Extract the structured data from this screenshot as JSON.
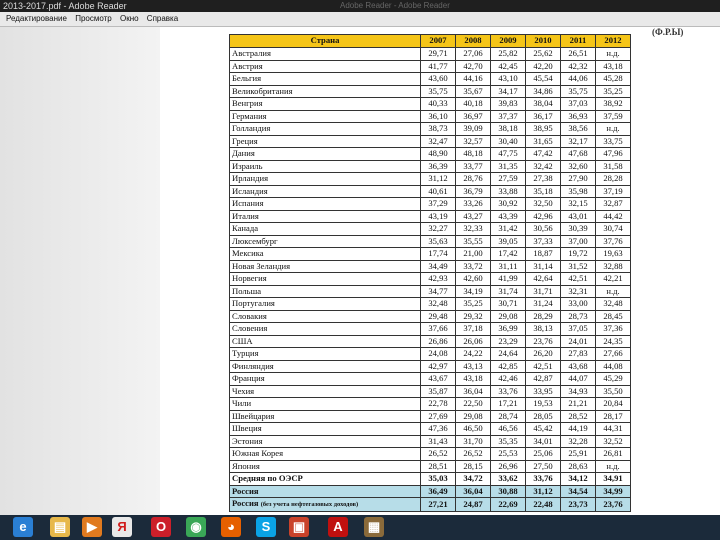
{
  "window": {
    "title": "2013-2017.pdf - Adobe Reader",
    "ghost_text": "Adobe Reader - Adobe Reader"
  },
  "menu": [
    "Редактирование",
    "Просмотр",
    "Окно",
    "Справка"
  ],
  "unit_label": "(Ф.Р.Ы)",
  "table": {
    "headers": [
      "Страна",
      "2007",
      "2008",
      "2009",
      "2010",
      "2011",
      "2012"
    ],
    "rows": [
      [
        "Австралия",
        "29,71",
        "27,06",
        "25,82",
        "25,62",
        "26,51",
        "н.д."
      ],
      [
        "Австрия",
        "41,77",
        "42,70",
        "42,45",
        "42,20",
        "42,32",
        "43,18"
      ],
      [
        "Бельгия",
        "43,60",
        "44,16",
        "43,10",
        "45,54",
        "44,06",
        "45,28"
      ],
      [
        "Великобритания",
        "35,75",
        "35,67",
        "34,17",
        "34,86",
        "35,75",
        "35,25"
      ],
      [
        "Венгрия",
        "40,33",
        "40,18",
        "39,83",
        "38,04",
        "37,03",
        "38,92"
      ],
      [
        "Германия",
        "36,10",
        "36,97",
        "37,37",
        "36,17",
        "36,93",
        "37,59"
      ],
      [
        "Голландия",
        "38,73",
        "39,09",
        "38,18",
        "38,95",
        "38,56",
        "н.д."
      ],
      [
        "Греция",
        "32,47",
        "32,57",
        "30,40",
        "31,65",
        "32,17",
        "33,75"
      ],
      [
        "Дания",
        "48,90",
        "48,18",
        "47,75",
        "47,42",
        "47,68",
        "47,96"
      ],
      [
        "Израиль",
        "36,39",
        "33,77",
        "31,35",
        "32,42",
        "32,60",
        "31,58"
      ],
      [
        "Ирландия",
        "31,12",
        "28,76",
        "27,59",
        "27,38",
        "27,90",
        "28,28"
      ],
      [
        "Исландия",
        "40,61",
        "36,79",
        "33,88",
        "35,18",
        "35,98",
        "37,19"
      ],
      [
        "Испания",
        "37,29",
        "33,26",
        "30,92",
        "32,50",
        "32,15",
        "32,87"
      ],
      [
        "Италия",
        "43,19",
        "43,27",
        "43,39",
        "42,96",
        "43,01",
        "44,42"
      ],
      [
        "Канада",
        "32,27",
        "32,33",
        "31,42",
        "30,56",
        "30,39",
        "30,74"
      ],
      [
        "Люксембург",
        "35,63",
        "35,55",
        "39,05",
        "37,33",
        "37,00",
        "37,76"
      ],
      [
        "Мексика",
        "17,74",
        "21,00",
        "17,42",
        "18,87",
        "19,72",
        "19,63"
      ],
      [
        "Новая Зеландия",
        "34,49",
        "33,72",
        "31,11",
        "31,14",
        "31,52",
        "32,88"
      ],
      [
        "Норвегия",
        "42,93",
        "42,60",
        "41,99",
        "42,64",
        "42,51",
        "42,21"
      ],
      [
        "Польша",
        "34,77",
        "34,19",
        "31,74",
        "31,71",
        "32,31",
        "н.д."
      ],
      [
        "Португалия",
        "32,48",
        "35,25",
        "30,71",
        "31,24",
        "33,00",
        "32,48"
      ],
      [
        "Словакия",
        "29,48",
        "29,32",
        "29,08",
        "28,29",
        "28,73",
        "28,45"
      ],
      [
        "Словения",
        "37,66",
        "37,18",
        "36,99",
        "38,13",
        "37,05",
        "37,36"
      ],
      [
        "США",
        "26,86",
        "26,06",
        "23,29",
        "23,76",
        "24,01",
        "24,35"
      ],
      [
        "Турция",
        "24,08",
        "24,22",
        "24,64",
        "26,20",
        "27,83",
        "27,66"
      ],
      [
        "Финляндия",
        "42,97",
        "43,13",
        "42,85",
        "42,51",
        "43,68",
        "44,08"
      ],
      [
        "Франция",
        "43,67",
        "43,18",
        "42,46",
        "42,87",
        "44,07",
        "45,29"
      ],
      [
        "Чехия",
        "35,87",
        "36,04",
        "33,76",
        "33,95",
        "34,93",
        "35,50"
      ],
      [
        "Чили",
        "22,78",
        "22,50",
        "17,21",
        "19,53",
        "21,21",
        "20,84"
      ],
      [
        "Швейцария",
        "27,69",
        "29,08",
        "28,74",
        "28,05",
        "28,52",
        "28,17"
      ],
      [
        "Швеция",
        "47,36",
        "46,50",
        "46,56",
        "45,42",
        "44,19",
        "44,31"
      ],
      [
        "Эстония",
        "31,43",
        "31,70",
        "35,35",
        "34,01",
        "32,28",
        "32,52"
      ],
      [
        "Южная Корея",
        "26,52",
        "26,52",
        "25,53",
        "25,06",
        "25,91",
        "26,81"
      ],
      [
        "Япония",
        "28,51",
        "28,15",
        "26,96",
        "27,50",
        "28,63",
        "н.д."
      ]
    ],
    "oecd_row": [
      "Средняя по ОЭСР",
      "35,03",
      "34,72",
      "33,62",
      "33,76",
      "34,12",
      "34,91"
    ],
    "russia_row": [
      "Россия",
      "36,49",
      "36,04",
      "30,88",
      "31,12",
      "34,54",
      "34,99"
    ],
    "russia_ex": {
      "label": "Россия",
      "note": "(без учета нефтегазовых доходов)",
      "values": [
        "27,21",
        "24,87",
        "22,69",
        "22,48",
        "23,73",
        "23,76"
      ]
    }
  },
  "taskbar": [
    {
      "name": "internet-explorer-icon",
      "glyph": "e",
      "color": "#2a7fd4"
    },
    {
      "name": "file-explorer-icon",
      "glyph": "▤",
      "color": "#e7b84a"
    },
    {
      "name": "media-player-icon",
      "glyph": "▶",
      "color": "#e07a1f"
    },
    {
      "name": "yandex-browser-icon",
      "glyph": "Я",
      "color": "#e8e8e8"
    },
    {
      "name": "opera-icon",
      "glyph": "O",
      "color": "#cc1f2a"
    },
    {
      "name": "chrome-icon",
      "glyph": "◉",
      "color": "#3aa757"
    },
    {
      "name": "firefox-icon",
      "glyph": "◕",
      "color": "#e66000"
    },
    {
      "name": "skype-icon",
      "glyph": "S",
      "color": "#0aa3e6"
    },
    {
      "name": "pdf-app-icon",
      "glyph": "▣",
      "color": "#c9422a"
    },
    {
      "name": "adobe-reader-icon",
      "glyph": "A",
      "color": "#c0100f"
    },
    {
      "name": "archive-icon",
      "glyph": "▦",
      "color": "#8a6a3a"
    }
  ]
}
